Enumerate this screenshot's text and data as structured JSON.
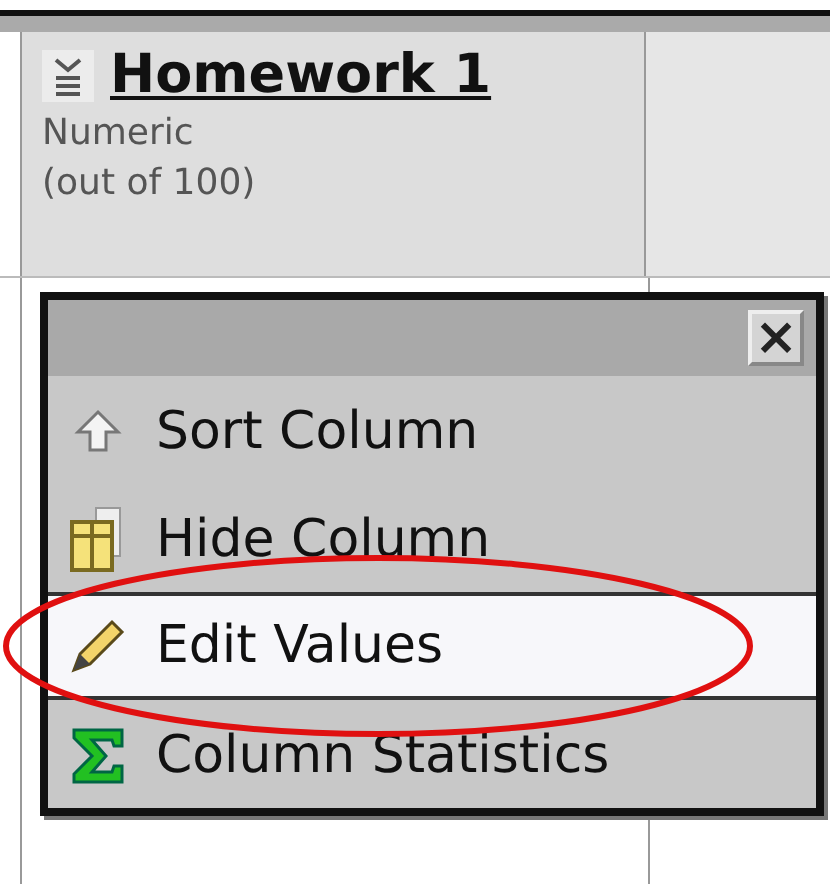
{
  "column_header": {
    "title": "Homework 1",
    "type": "Numeric",
    "scale": "(out of 100)"
  },
  "menu": {
    "close": "×",
    "items": [
      {
        "kind": "sort",
        "label": "Sort Column",
        "selected": false,
        "circled": false
      },
      {
        "kind": "hide",
        "label": "Hide Column",
        "selected": false,
        "circled": false
      },
      {
        "kind": "edit",
        "label": "Edit Values",
        "selected": true,
        "circled": true
      },
      {
        "kind": "stats",
        "label": "Column Statistics",
        "selected": false,
        "circled": false
      }
    ]
  }
}
